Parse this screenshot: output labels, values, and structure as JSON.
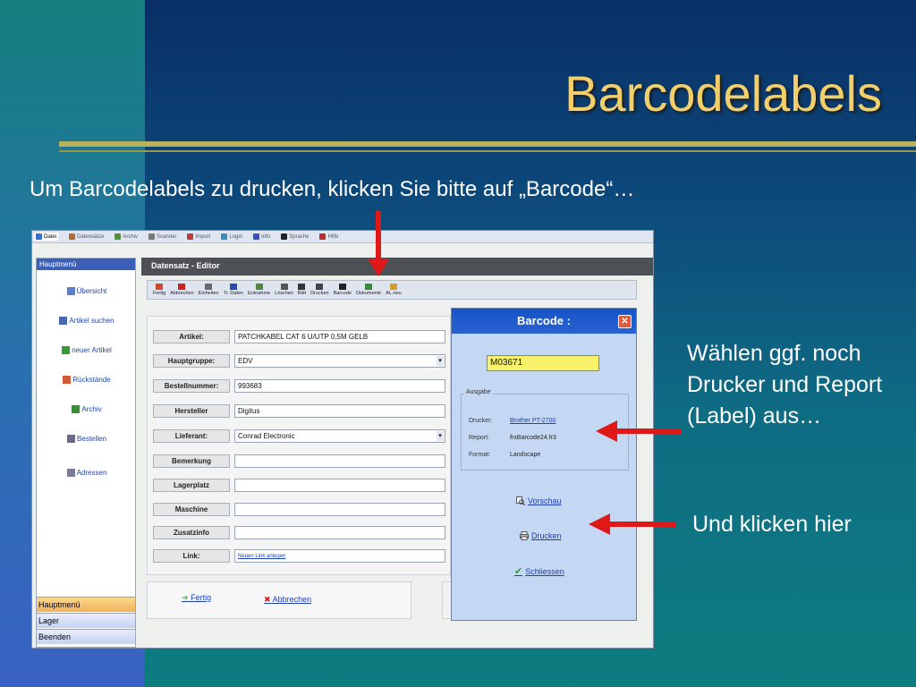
{
  "slide": {
    "title": "Barcodelabels",
    "intro": "Um Barcodelabels zu drucken, klicken Sie bitte auf „Barcode“…",
    "note_select": "Wählen ggf. noch Drucker und Report (Label) aus…",
    "note_click": "Und klicken hier"
  },
  "menubar": [
    {
      "label": "Datei",
      "icon": "folder-icon"
    },
    {
      "label": "Datensätze",
      "icon": "list-icon"
    },
    {
      "label": "Archiv",
      "icon": "archive-icon"
    },
    {
      "label": "Scanner",
      "icon": "scanner-icon"
    },
    {
      "label": "Import",
      "icon": "import-icon"
    },
    {
      "label": "Login",
      "icon": "login-icon"
    },
    {
      "label": "Info",
      "icon": "info-icon"
    },
    {
      "label": "Sprache",
      "icon": "language-icon"
    },
    {
      "label": "Hilfe",
      "icon": "help-icon"
    }
  ],
  "sidebar": {
    "header": "Hauptmenü",
    "items": [
      {
        "label": "Übersicht",
        "icon": "overview-icon"
      },
      {
        "label": "Artikel suchen",
        "icon": "search-icon"
      },
      {
        "label": "neuer Artikel",
        "icon": "new-item-icon"
      },
      {
        "label": "Rückstände",
        "icon": "backlog-icon"
      },
      {
        "label": "Archiv",
        "icon": "archive-icon"
      },
      {
        "label": "Bestellen",
        "icon": "order-icon"
      },
      {
        "label": "Adressen",
        "icon": "address-icon"
      }
    ],
    "bottom": [
      "Hauptmenü",
      "Lager",
      "Beenden"
    ]
  },
  "editor": {
    "header": "Datensatz  -  Editor",
    "toolbar": [
      {
        "label": "Fertig",
        "icon": "done-icon"
      },
      {
        "label": "Abbrechen",
        "icon": "cancel-icon"
      },
      {
        "label": "Einheiten",
        "icon": "units-icon"
      },
      {
        "label": "Tr. Daten",
        "icon": "data-icon"
      },
      {
        "label": "Entnahme",
        "icon": "withdraw-icon"
      },
      {
        "label": "Löschen",
        "icon": "delete-icon"
      },
      {
        "label": "Bild",
        "icon": "image-icon"
      },
      {
        "label": "Drucken",
        "icon": "print-icon"
      },
      {
        "label": "Barcode",
        "icon": "barcode-icon"
      },
      {
        "label": "Dokumente",
        "icon": "documents-icon"
      },
      {
        "label": "AL.neu",
        "icon": "new-list-icon"
      }
    ],
    "fields": [
      {
        "label": "Artikel:",
        "value": "PATCHKABEL CAT 6 U/UTP 0,5M GELB",
        "kind": "text"
      },
      {
        "label": "Hauptgruppe:",
        "value": "EDV",
        "kind": "combo"
      },
      {
        "label": "Bestellnummer:",
        "value": "993683",
        "kind": "text"
      },
      {
        "label": "Hersteller",
        "value": "Digitus",
        "kind": "text"
      },
      {
        "label": "Lieferant:",
        "value": "Conrad Electronic",
        "kind": "combo"
      },
      {
        "label": "Bemerkung",
        "value": "",
        "kind": "text"
      },
      {
        "label": "Lagerplatz",
        "value": "",
        "kind": "text"
      },
      {
        "label": "Maschine",
        "value": "",
        "kind": "text"
      },
      {
        "label": "Zusatzinfo",
        "value": "",
        "kind": "text"
      },
      {
        "label": "Link:",
        "value": "Neuen Link anlegen",
        "kind": "link"
      }
    ],
    "footer": {
      "done": "Fertig",
      "cancel": "Abbrechen"
    }
  },
  "barcode_dialog": {
    "title": "Barcode :",
    "code": "M03671",
    "group_label": "Ausgabe",
    "printer_key": "Drucker:",
    "printer_value": "Brother PT-2700",
    "report_key": "Report:",
    "report_value": "frxBarcode24.fr3",
    "format_key": "Format:",
    "format_value": "Landscape",
    "preview": "Vorschau",
    "print": "Drucken",
    "close": "Schliessen"
  },
  "colors": {
    "title": "#f2cf6b",
    "arrow": "#e01818",
    "dialog_title": "#1554c8"
  }
}
